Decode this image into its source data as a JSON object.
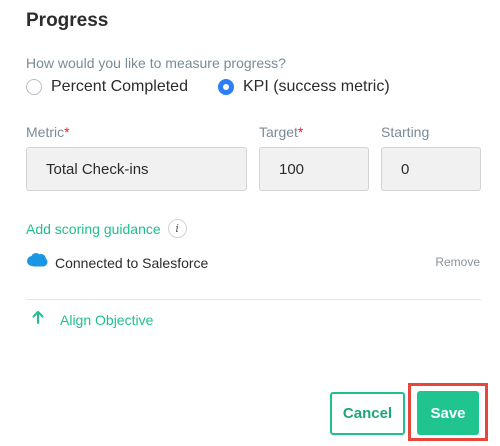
{
  "section": {
    "title": "Progress"
  },
  "measure": {
    "question": "How would you like to measure progress?",
    "options": [
      {
        "label": "Percent Completed",
        "selected": false
      },
      {
        "label": "KPI (success metric)",
        "selected": true
      }
    ]
  },
  "fields": {
    "metric": {
      "label": "Metric",
      "required_mark": "*",
      "value": "Total Check-ins"
    },
    "target": {
      "label": "Target",
      "required_mark": "*",
      "value": "100"
    },
    "starting": {
      "label": "Starting",
      "value": "0"
    }
  },
  "guidance": {
    "link": "Add scoring guidance",
    "info_icon": "i"
  },
  "salesforce": {
    "label": "Connected to Salesforce",
    "remove": "Remove",
    "icon": "salesforce-cloud-icon",
    "color": "#1b96e4"
  },
  "align": {
    "label": "Align Objective",
    "icon": "arrow-up-icon"
  },
  "buttons": {
    "cancel": "Cancel",
    "save": "Save"
  },
  "colors": {
    "accent": "#1fc48e",
    "radio_selected": "#2d7ff9",
    "highlight": "#e8463c",
    "required": "#e0202b"
  }
}
